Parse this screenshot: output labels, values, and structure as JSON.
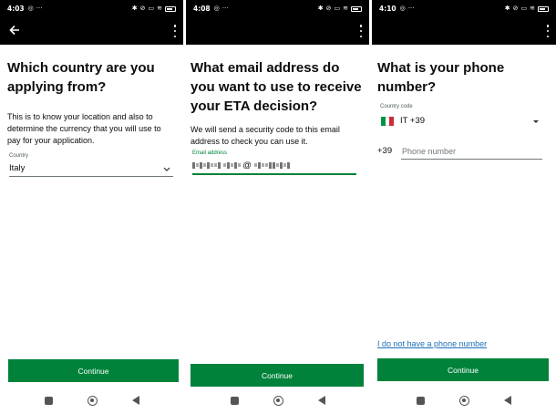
{
  "screens": [
    {
      "time": "4:03",
      "heading": "Which country are you applying from?",
      "hint": "This is to know your location and also to determine the currency that you will use to pay for your application.",
      "field_label": "Country",
      "field_value": "Italy",
      "button": "Continue"
    },
    {
      "time": "4:08",
      "heading": "What email address do you want to use to receive your ETA decision?",
      "hint": "We will send a security code to this email address to check you can use it.",
      "field_label": "Email address",
      "field_value_visible_char": "@",
      "button": "Continue"
    },
    {
      "time": "4:10",
      "heading": "What is your phone number?",
      "field_label": "Country code",
      "country_code": "IT +39",
      "prefix": "+39",
      "phone_placeholder": "Phone number",
      "link": "I do not have a phone number",
      "button": "Continue"
    }
  ],
  "colors": {
    "button_green": "#00823b",
    "link_blue": "#1d70b8",
    "flag_green": "#009246",
    "flag_white": "#ffffff",
    "flag_red": "#ce2b37"
  }
}
